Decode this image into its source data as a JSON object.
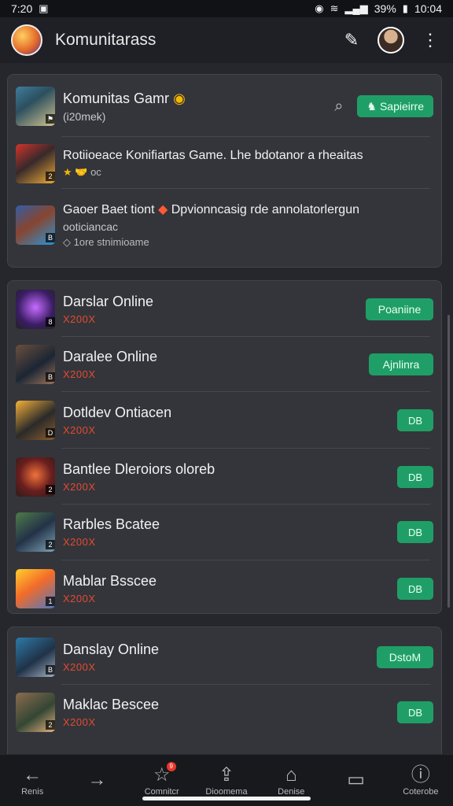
{
  "status": {
    "time_left": "7:20",
    "battery": "39%",
    "time_right": "10:04"
  },
  "app_bar": {
    "title": "Komunitarass"
  },
  "featured": {
    "header_title": "Komunitas Gamr",
    "header_subtitle": "(i20mek)",
    "join_label": "Sapieirre",
    "post_one": "Rotiioeace Konifiartas Game. Lhe bdotanor a rheaitas",
    "post_one_meta": "🤝 oc",
    "post_two": "Gaoer Baet tiont",
    "post_two_tail": "Dpvionncasig rde annolatorlergun",
    "post_two_sub": "ooticiancac",
    "post_two_meta": "1ore stnimioame"
  },
  "games": [
    {
      "title": "Darslar Online",
      "score": "X200X",
      "badge": "Poaniine"
    },
    {
      "title": "Daralee Online",
      "score": "X200X",
      "badge": "Ajnlinra"
    },
    {
      "title": "Dotldev Ontiacen",
      "score": "X200X",
      "badge": "DB"
    },
    {
      "title": "Bantlee Dleroiors oloreb",
      "score": "X200X",
      "badge": "DB"
    },
    {
      "title": "Rarbles Bcatee",
      "score": "X200X",
      "badge": "DB"
    },
    {
      "title": "Mablar Bsscee",
      "score": "X200X",
      "badge": "DB"
    }
  ],
  "games2": [
    {
      "title": "Danslay Online",
      "score": "X200X",
      "badge": "DstoM"
    },
    {
      "title": "Maklac Bescee",
      "score": "X200X",
      "badge": "DB"
    }
  ],
  "nav": [
    {
      "label": "Renis",
      "icon": "arrow-left-icon"
    },
    {
      "label": "",
      "icon": "arrow-right-icon"
    },
    {
      "label": "Comnitcr",
      "icon": "star-icon",
      "badge": "9"
    },
    {
      "label": "Dioomema",
      "icon": "share-icon"
    },
    {
      "label": "Denise",
      "icon": "bookmark-icon"
    },
    {
      "label": "",
      "icon": "window-icon"
    },
    {
      "label": "Coterobe",
      "icon": "info-icon"
    }
  ],
  "colors": {
    "background": "#26272c",
    "card": "#34353b",
    "accent_green": "#1f9f67",
    "score_red": "#e34b2f"
  }
}
